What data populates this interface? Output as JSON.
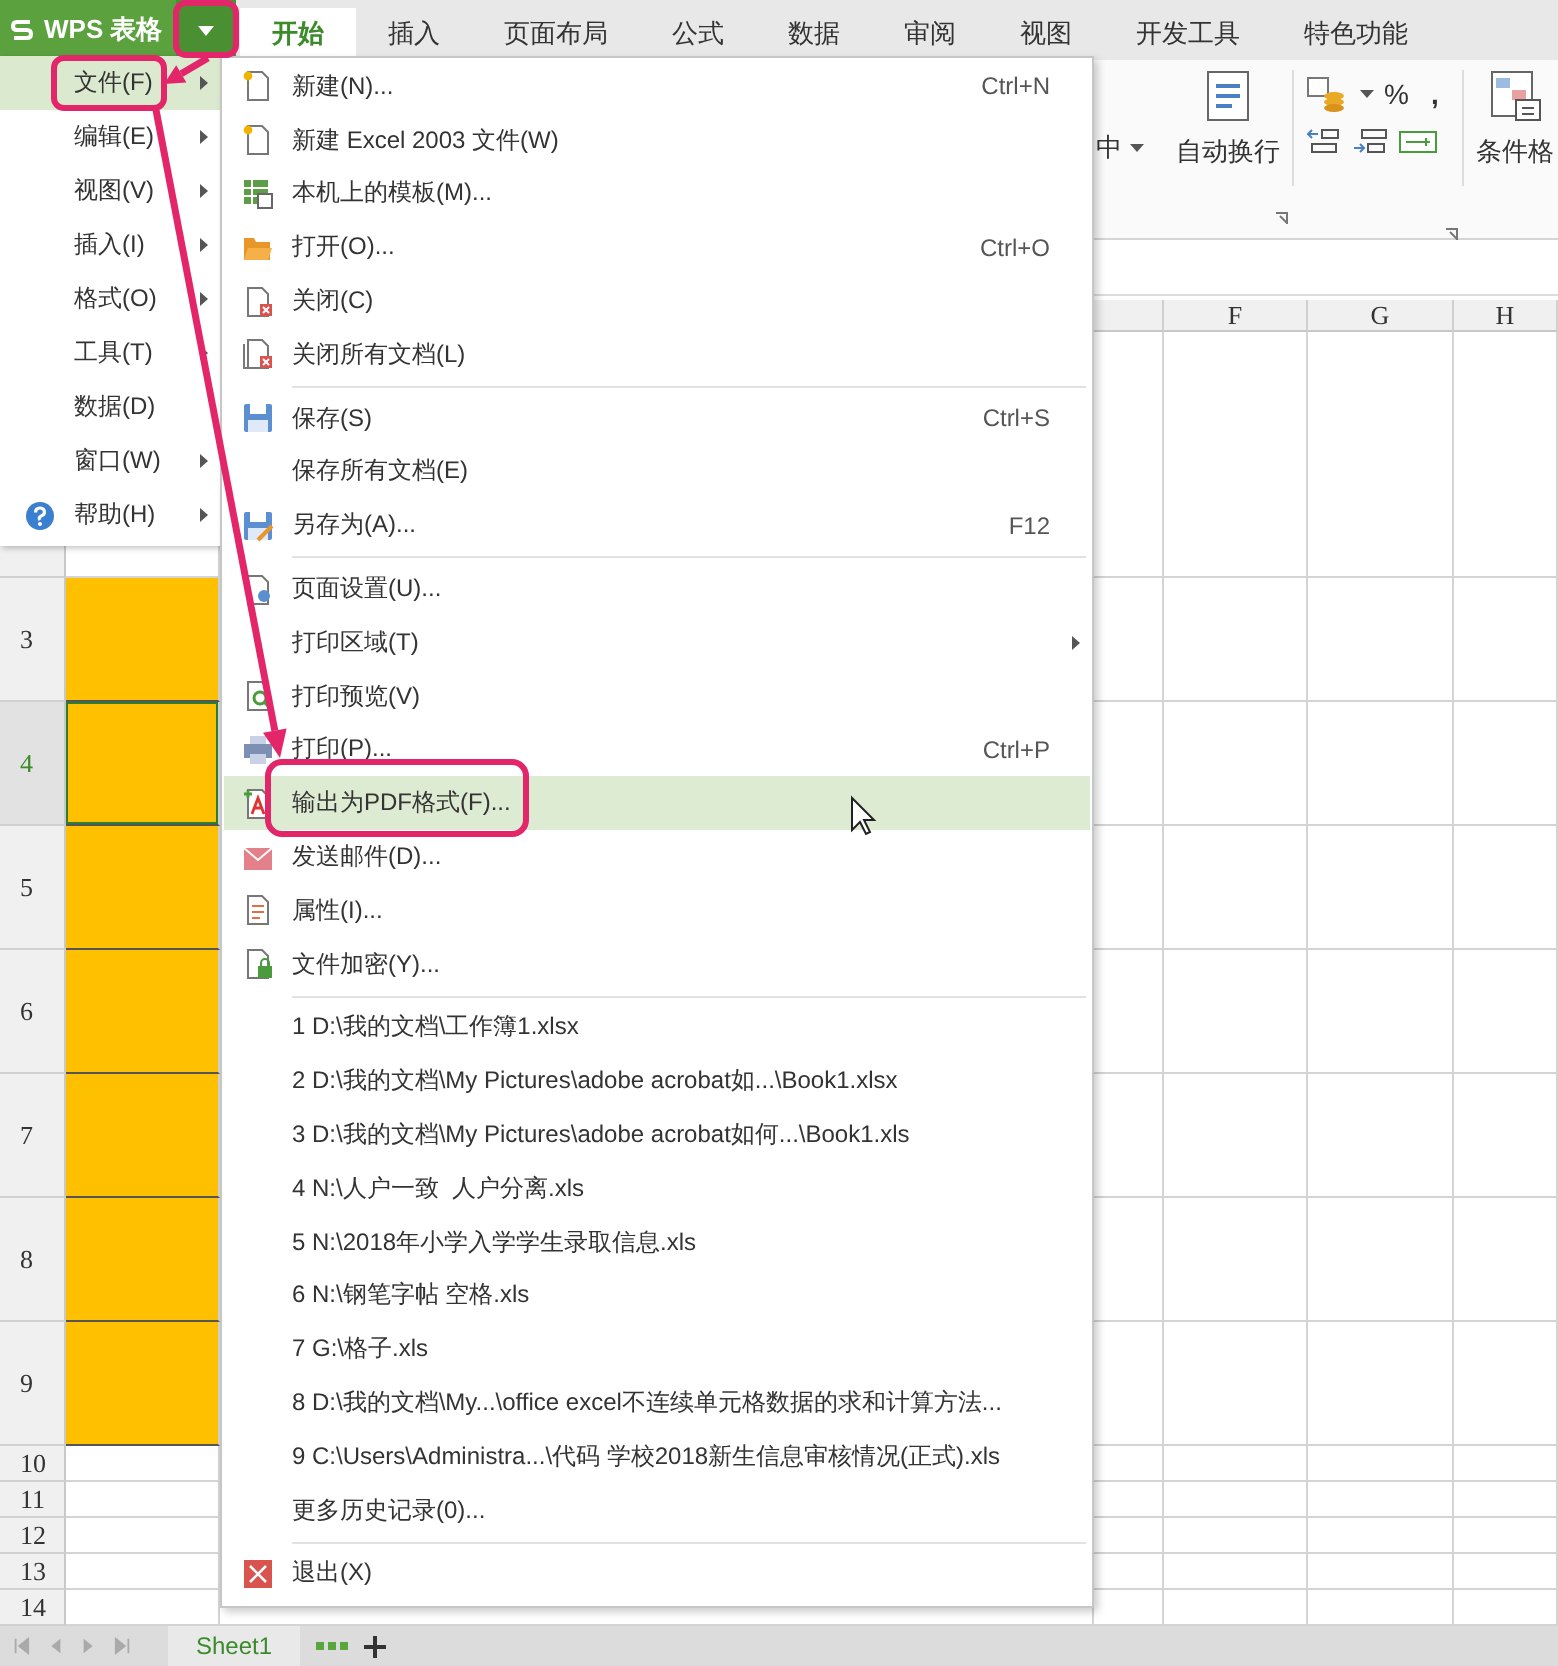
{
  "app_button": {
    "label": "WPS 表格"
  },
  "ribbon_tabs": [
    {
      "label": "开始",
      "selected": true
    },
    {
      "label": "插入",
      "selected": false
    },
    {
      "label": "页面布局",
      "selected": false
    },
    {
      "label": "公式",
      "selected": false
    },
    {
      "label": "数据",
      "selected": false
    },
    {
      "label": "审阅",
      "selected": false
    },
    {
      "label": "视图",
      "selected": false
    },
    {
      "label": "开发工具",
      "selected": false
    },
    {
      "label": "特色功能",
      "selected": false
    }
  ],
  "ribbon": {
    "merge_label": "中",
    "wrap_label": "自动换行",
    "percent": "%",
    "comma": ",",
    "conditional_format_label": "条件格"
  },
  "columns": [
    "F",
    "G",
    "H"
  ],
  "rows": [
    {
      "label": "3",
      "selected": false,
      "highlighted": true,
      "kind": "tall"
    },
    {
      "label": "4",
      "selected": true,
      "highlighted": true,
      "kind": "tall"
    },
    {
      "label": "5",
      "selected": false,
      "highlighted": true,
      "kind": "tall"
    },
    {
      "label": "6",
      "selected": false,
      "highlighted": true,
      "kind": "tall"
    },
    {
      "label": "7",
      "selected": false,
      "highlighted": true,
      "kind": "tall"
    },
    {
      "label": "8",
      "selected": false,
      "highlighted": true,
      "kind": "tall"
    },
    {
      "label": "9",
      "selected": false,
      "highlighted": true,
      "kind": "tall"
    },
    {
      "label": "10",
      "selected": false,
      "highlighted": false,
      "kind": "short"
    },
    {
      "label": "11",
      "selected": false,
      "highlighted": false,
      "kind": "short"
    },
    {
      "label": "12",
      "selected": false,
      "highlighted": false,
      "kind": "short"
    },
    {
      "label": "13",
      "selected": false,
      "highlighted": false,
      "kind": "short"
    },
    {
      "label": "14",
      "selected": false,
      "highlighted": false,
      "kind": "short"
    }
  ],
  "main_menu": {
    "items": [
      {
        "label": "文件(F)",
        "selected": true,
        "submenu": true,
        "help_icon": false
      },
      {
        "label": "编辑(E)",
        "selected": false,
        "submenu": true,
        "help_icon": false
      },
      {
        "label": "视图(V)",
        "selected": false,
        "submenu": true,
        "help_icon": false
      },
      {
        "label": "插入(I)",
        "selected": false,
        "submenu": true,
        "help_icon": false
      },
      {
        "label": "格式(O)",
        "selected": false,
        "submenu": true,
        "help_icon": false
      },
      {
        "label": "工具(T)",
        "selected": false,
        "submenu": true,
        "help_icon": false
      },
      {
        "label": "数据(D)",
        "selected": false,
        "submenu": false,
        "help_icon": false
      },
      {
        "label": "窗口(W)",
        "selected": false,
        "submenu": true,
        "help_icon": false
      },
      {
        "label": "帮助(H)",
        "selected": false,
        "submenu": true,
        "help_icon": true
      }
    ]
  },
  "file_menu": {
    "sections": [
      [
        {
          "label": "新建(N)...",
          "shortcut": "Ctrl+N",
          "selected": false,
          "submenu": false
        },
        {
          "label": "新建 Excel 2003 文件(W)",
          "selected": false,
          "submenu": false
        },
        {
          "label": "本机上的模板(M)...",
          "selected": false,
          "submenu": false
        },
        {
          "label": "打开(O)...",
          "shortcut": "Ctrl+O",
          "selected": false,
          "submenu": false
        },
        {
          "label": "关闭(C)",
          "selected": false,
          "submenu": false
        },
        {
          "label": "关闭所有文档(L)",
          "selected": false,
          "submenu": false
        }
      ],
      [
        {
          "label": "保存(S)",
          "shortcut": "Ctrl+S",
          "selected": false,
          "submenu": false
        },
        {
          "label": "保存所有文档(E)",
          "selected": false,
          "submenu": false
        },
        {
          "label": "另存为(A)...",
          "shortcut": "F12",
          "selected": false,
          "submenu": false
        }
      ],
      [
        {
          "label": "页面设置(U)...",
          "selected": false,
          "submenu": false
        },
        {
          "label": "打印区域(T)",
          "selected": false,
          "submenu": true
        },
        {
          "label": "打印预览(V)",
          "selected": false,
          "submenu": false
        },
        {
          "label": "打印(P)...",
          "shortcut": "Ctrl+P",
          "selected": false,
          "submenu": false
        },
        {
          "label": "输出为PDF格式(F)...",
          "selected": true,
          "submenu": false
        },
        {
          "label": "发送邮件(D)...",
          "selected": false,
          "submenu": false
        },
        {
          "label": "属性(I)...",
          "selected": false,
          "submenu": false
        },
        {
          "label": "文件加密(Y)...",
          "selected": false,
          "submenu": false
        }
      ],
      [
        {
          "label": "1 D:\\我的文档\\工作簿1.xlsx",
          "selected": false,
          "submenu": false
        },
        {
          "label": "2 D:\\我的文档\\My Pictures\\adobe acrobat如...\\Book1.xlsx",
          "selected": false,
          "submenu": false
        },
        {
          "label": "3 D:\\我的文档\\My Pictures\\adobe acrobat如何...\\Book1.xls",
          "selected": false,
          "submenu": false
        },
        {
          "label": "4 N:\\人户一致  人户分离.xls",
          "selected": false,
          "submenu": false
        },
        {
          "label": "5 N:\\2018年小学入学学生录取信息.xls",
          "selected": false,
          "submenu": false
        },
        {
          "label": "6 N:\\钢笔字帖 空格.xls",
          "selected": false,
          "submenu": false
        },
        {
          "label": "7 G:\\格子.xls",
          "selected": false,
          "submenu": false
        },
        {
          "label": "8 D:\\我的文档\\My...\\office excel不连续单元格数据的求和计算方法...",
          "selected": false,
          "submenu": false
        },
        {
          "label": "9 C:\\Users\\Administra...\\代码 学校2018新生信息审核情况(正式).xls",
          "selected": false,
          "submenu": false
        },
        {
          "label": "更多历史记录(0)...",
          "selected": false,
          "submenu": false
        }
      ],
      [
        {
          "label": "退出(X)",
          "selected": false,
          "submenu": false
        }
      ]
    ]
  },
  "sheet_tabs": [
    {
      "label": "Sheet1",
      "selected": true
    }
  ]
}
